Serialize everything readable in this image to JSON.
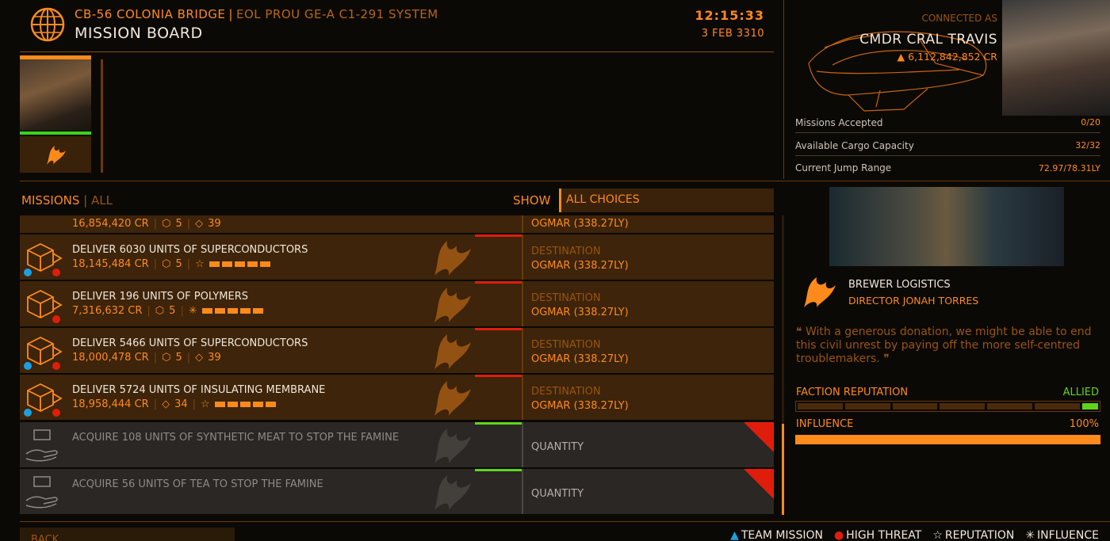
{
  "header": {
    "station": "CB-56 COLONIA BRIDGE",
    "system": "EOL PROU GE-A C1-291 SYSTEM",
    "board_title": "MISSION BOARD",
    "time": "12:15:33",
    "date": "3 FEB 3310"
  },
  "commander": {
    "connected_as": "CONNECTED AS",
    "name": "CMDR CRAL TRAVIS",
    "credits": "6,112,842,852 CR",
    "stats": [
      {
        "label": "Missions Accepted",
        "value": "0/20"
      },
      {
        "label": "Available Cargo Capacity",
        "value": "32/32"
      },
      {
        "label": "Current Jump Range",
        "value": "72.97/78.31LY"
      }
    ]
  },
  "missions": {
    "label": "MISSIONS",
    "filter_tab": "ALL",
    "show_label": "SHOW",
    "show_value": "ALL CHOICES",
    "partial_row": {
      "reward": "16,854,420 CR",
      "rep": "5",
      "value": "39",
      "dest": "OGMAR (338.27LY)"
    },
    "rows": [
      {
        "title": "DELIVER 6030 UNITS OF SUPERCONDUCTORS",
        "reward": "18,145,484 CR",
        "rep": "5",
        "extra_type": "reputation",
        "dest_label": "DESTINATION",
        "dest": "OGMAR (338.27LY)"
      },
      {
        "title": "DELIVER 196 UNITS OF POLYMERS",
        "reward": "7,316,632 CR",
        "rep": "5",
        "extra_type": "influence",
        "dest_label": "DESTINATION",
        "dest": "OGMAR (338.27LY)"
      },
      {
        "title": "DELIVER 5466 UNITS OF SUPERCONDUCTORS",
        "reward": "18,000,478 CR",
        "rep": "5",
        "extra_value": "39",
        "dest_label": "DESTINATION",
        "dest": "OGMAR (338.27LY)"
      },
      {
        "title": "DELIVER 5724 UNITS OF INSULATING MEMBRANE",
        "reward": "18,958,444 CR",
        "rep": "34",
        "extra_type": "reputation",
        "dest_label": "DESTINATION",
        "dest": "OGMAR (338.27LY)"
      },
      {
        "title": "ACQUIRE 108 UNITS OF SYNTHETIC MEAT TO STOP THE FAMINE",
        "qty_label": "QUANTITY"
      },
      {
        "title": "ACQUIRE 56 UNITS OF TEA TO STOP THE FAMINE",
        "qty_label": "QUANTITY"
      }
    ]
  },
  "faction": {
    "name": "BREWER LOGISTICS",
    "director": "DIRECTOR JONAH TORRES",
    "quote": "With a generous donation, we might be able to end this civil unrest by paying off the more self-centred troublemakers.",
    "reputation_label": "FACTION REPUTATION",
    "reputation_value": "ALLIED",
    "influence_label": "INFLUENCE",
    "influence_value": "100%"
  },
  "footer": {
    "back": "BACK",
    "legend": [
      "TEAM MISSION",
      "HIGH THREAT",
      "REPUTATION",
      "INFLUENCE"
    ]
  },
  "colors": {
    "accent": "#ff8a1c",
    "threat": "#e01d0b",
    "allied": "#5fd41a",
    "team": "#1aa0e0"
  }
}
